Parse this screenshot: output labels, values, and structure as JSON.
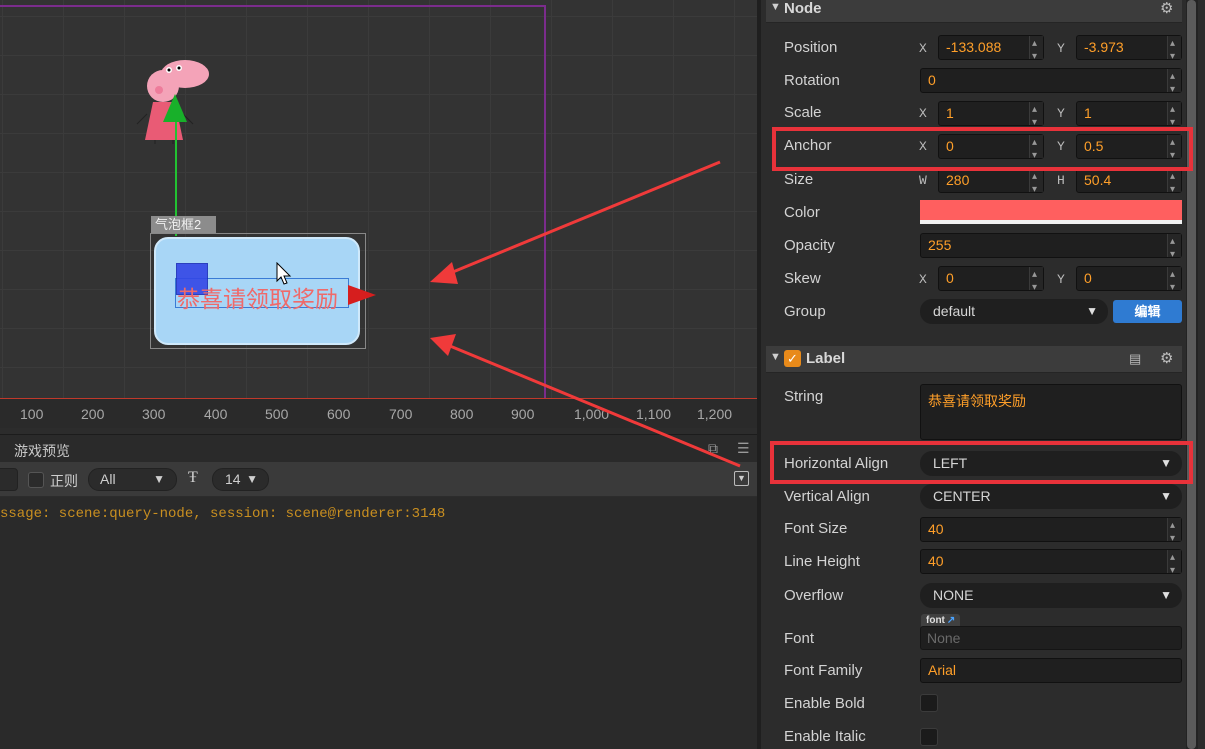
{
  "scene": {
    "node_name": "气泡框2",
    "label_text": "恭喜请领取奖励",
    "ruler_ticks": [
      "100",
      "200",
      "300",
      "400",
      "500",
      "600",
      "700",
      "800",
      "900",
      "1,000",
      "1,100",
      "1,200"
    ]
  },
  "console": {
    "title": "游戏预览",
    "regex_label": "正则",
    "filter_value": "All",
    "font_size_value": "14",
    "log_line": "ssage: scene:query-node, session: scene@renderer:3148"
  },
  "inspector": {
    "node_section": "Node",
    "label_section": "Label",
    "position": {
      "label": "Position",
      "x": "-133.088",
      "y": "-3.973"
    },
    "rotation": {
      "label": "Rotation",
      "value": "0"
    },
    "scale": {
      "label": "Scale",
      "x": "1",
      "y": "1"
    },
    "anchor": {
      "label": "Anchor",
      "x": "0",
      "y": "0.5"
    },
    "size": {
      "label": "Size",
      "w": "280",
      "h": "50.4"
    },
    "color": {
      "label": "Color",
      "value": "#ff5f5f"
    },
    "opacity": {
      "label": "Opacity",
      "value": "255"
    },
    "skew": {
      "label": "Skew",
      "x": "0",
      "y": "0"
    },
    "group": {
      "label": "Group",
      "value": "default",
      "edit_button": "编辑"
    },
    "string": {
      "label": "String",
      "value": "恭喜请领取奖励"
    },
    "horizontal_align": {
      "label": "Horizontal Align",
      "value": "LEFT"
    },
    "vertical_align": {
      "label": "Vertical Align",
      "value": "CENTER"
    },
    "font_size": {
      "label": "Font Size",
      "value": "40"
    },
    "line_height": {
      "label": "Line Height",
      "value": "40"
    },
    "overflow": {
      "label": "Overflow",
      "value": "NONE"
    },
    "font": {
      "label": "Font",
      "tag": "font",
      "value": "None"
    },
    "font_family": {
      "label": "Font Family",
      "value": "Arial"
    },
    "enable_bold": {
      "label": "Enable Bold"
    },
    "enable_italic": {
      "label": "Enable Italic"
    },
    "axis_x": "X",
    "axis_y": "Y",
    "axis_w": "W",
    "axis_h": "H"
  }
}
